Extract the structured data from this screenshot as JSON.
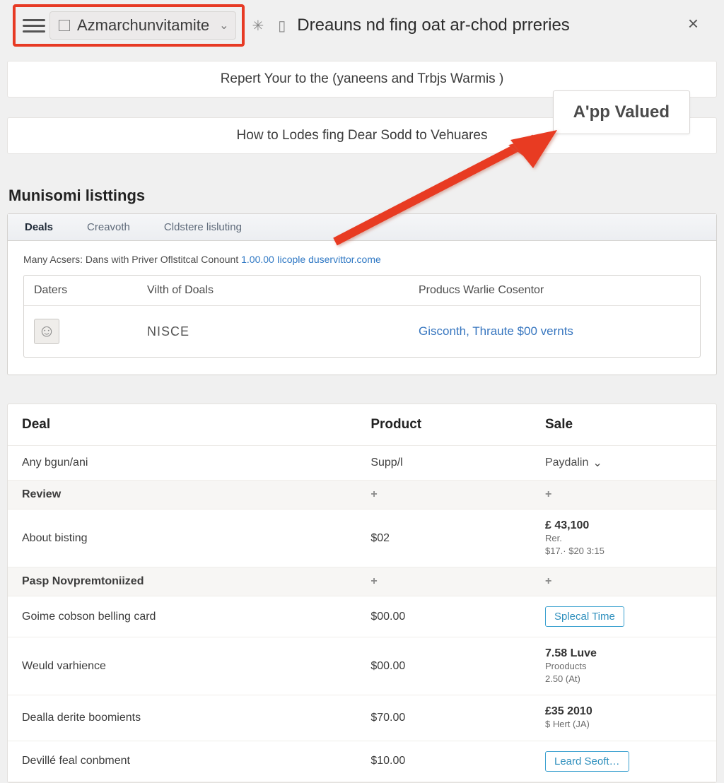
{
  "topbar": {
    "app_name": "Azmarchunvitamite",
    "headline": "Dreauns nd fing oat ar-chod prreries"
  },
  "close_label": "×",
  "banner1": "Repert Your to the (yaneens and Trbjs Warmis )",
  "banner2": "How to Lodes fing Dear Sodd to Vehuares",
  "callout": "A'pp Valued",
  "section_title": "Munisomi listtings",
  "tabs": [
    "Deals",
    "Creavoth",
    "Cldstere lisluting"
  ],
  "sub_note_prefix": "Many Acsers: Dans with Priver Oflstitcal Conount ",
  "sub_note_link": "1.00.00 Iicople duservittor.come",
  "innerbox": {
    "headers": [
      "Daters",
      "Vilth of Doals",
      "Producs Warlie Cosentor"
    ],
    "row": {
      "avatar": "☺",
      "name": "NISCE",
      "link": "Gisconth, Thraute $00 vernts"
    }
  },
  "grid": {
    "headers": [
      "Deal",
      "Product",
      "Sale"
    ],
    "filter_row": {
      "deal": "Any bgun/ani",
      "product": "Supp/l",
      "sale": "Paydalin"
    },
    "rows": [
      {
        "type": "subhdr",
        "deal": "Review",
        "product": "+",
        "sale": "+"
      },
      {
        "type": "data",
        "deal": "About bisting",
        "product": "$02",
        "sale_lines": [
          "£ 43,100",
          "Rer.",
          "$17.·  $20 3:15"
        ]
      },
      {
        "type": "subhdr",
        "deal": "Pasp Novpremtoniized",
        "product": "+",
        "sale": "+"
      },
      {
        "type": "data",
        "deal": "Goime cobson belling card",
        "product": "$00.00",
        "sale_pill": "Splecal Time"
      },
      {
        "type": "data",
        "deal": "Weuld varhience",
        "product": "$00.00",
        "sale_lines": [
          "7.58  Luve",
          "Prooducts",
          "2.50  (At)"
        ]
      },
      {
        "type": "data",
        "deal": "Dealla derite boomients",
        "product": "$70.00",
        "sale_lines": [
          "£35  2010",
          "$ Hert  (JA)"
        ]
      },
      {
        "type": "data",
        "deal": "Devillé feal conbment",
        "product": "$10.00",
        "sale_pill": "Leard Seoft…"
      }
    ]
  }
}
